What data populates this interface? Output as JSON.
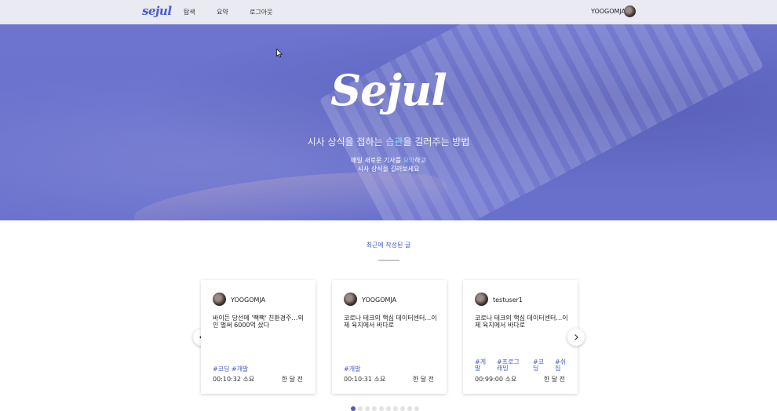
{
  "nav": {
    "logo": "sejul",
    "links": [
      "탐색",
      "요약",
      "로그아웃"
    ],
    "user": "YOOGOMJA"
  },
  "hero": {
    "logo": "Sejul",
    "tagline_pre": "시사 상식을 접하는 ",
    "tagline_accent": "습관",
    "tagline_post": "을 길러주는 방법",
    "sub1_pre": "매일 새로운 기사를 ",
    "sub1_accent": "요약",
    "sub1_post": "하고",
    "sub2": "시사 상식을 길러보세요"
  },
  "section": {
    "title": "최근에 작성된 글"
  },
  "cards": [
    {
      "author": "YOOGOMJA",
      "title": "바이든 당선에 '짹짹' 친환경주…외인 벌써 6000억 샀다",
      "tags": "#코딩 #개발",
      "duration": "00:10:32 소요",
      "time": "한 달 전"
    },
    {
      "author": "YOOGOMJA",
      "title": "코로나 테크의 핵심 데이터센터…이제 육지에서 바다로",
      "tags": "#개발",
      "duration": "00:10:31 소요",
      "time": "한 달 전"
    },
    {
      "author": "testuser1",
      "title": "코로나 테크의 핵심 데이터센터…이제 육지에서 바다로",
      "tags_list": [
        "#게발",
        "#프로그래밍",
        "#코딩",
        "#쉬짐"
      ],
      "duration": "00:99:00 소요",
      "time": "한 달 전"
    }
  ],
  "carousel": {
    "page_count": 10,
    "active_index": 0
  },
  "icons": {
    "prev": "chevron-left-icon",
    "next": "chevron-right-icon",
    "cursor": "mouse-cursor-icon"
  },
  "colors": {
    "accent": "#4a5bc7",
    "hero_overlay": "#6870cc",
    "hero_highlight": "#93e0ff",
    "nav_bg": "#e9eaf2"
  }
}
